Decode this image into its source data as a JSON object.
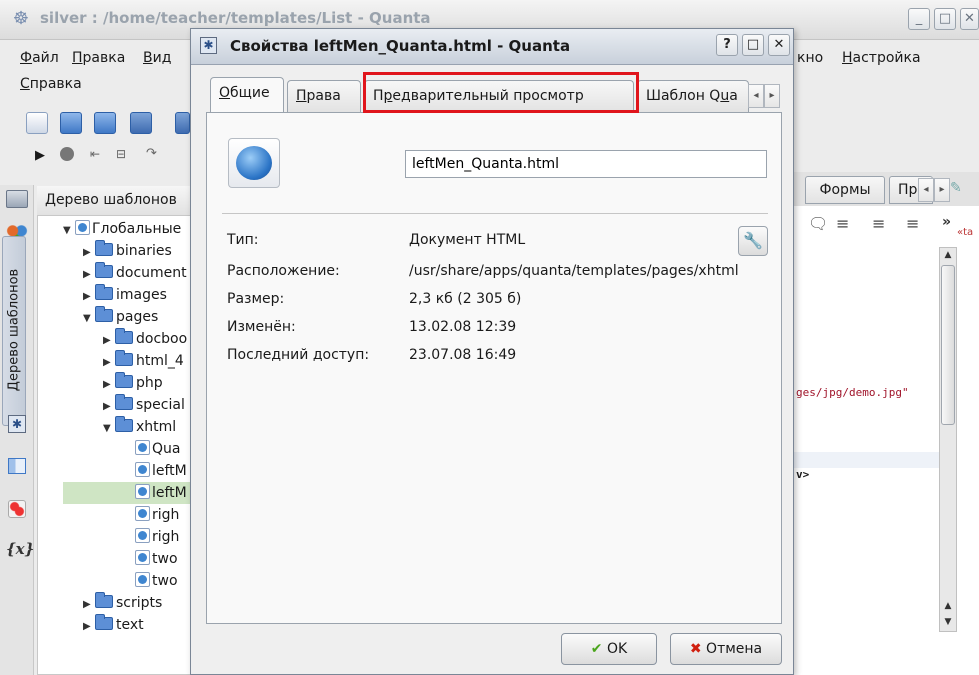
{
  "main_window": {
    "title": "silver : /home/teacher/templates/List - Quanta",
    "menu": [
      {
        "label": "Файл",
        "underline": "Ф",
        "rest": "айл"
      },
      {
        "label": "Правка",
        "underline": "П",
        "rest": "равка"
      },
      {
        "label": "Вид",
        "underline": "В",
        "rest": "ид"
      }
    ],
    "menu_right": [
      {
        "label": "кно"
      },
      {
        "label": "Настройка",
        "underline": "Н",
        "rest": "астройка"
      }
    ],
    "menu_row2": {
      "label": "Справка",
      "underline": "С",
      "rest": "правка"
    },
    "side_tab_label": "Дерево шаблонов",
    "tree_header": "Дерево шаблонов",
    "tree": [
      {
        "label": "Глобальные",
        "indent": 0,
        "expanded": true,
        "kind": "root"
      },
      {
        "label": "binaries",
        "indent": 1,
        "expanded": false,
        "kind": "folder"
      },
      {
        "label": "document",
        "indent": 1,
        "expanded": false,
        "kind": "folder"
      },
      {
        "label": "images",
        "indent": 1,
        "expanded": false,
        "kind": "folder"
      },
      {
        "label": "pages",
        "indent": 1,
        "expanded": true,
        "kind": "folder"
      },
      {
        "label": "docboo",
        "indent": 2,
        "expanded": false,
        "kind": "folder"
      },
      {
        "label": "html_4",
        "indent": 2,
        "expanded": false,
        "kind": "folder"
      },
      {
        "label": "php",
        "indent": 2,
        "expanded": false,
        "kind": "folder"
      },
      {
        "label": "special",
        "indent": 2,
        "expanded": false,
        "kind": "folder"
      },
      {
        "label": "xhtml",
        "indent": 2,
        "expanded": true,
        "kind": "folder"
      },
      {
        "label": "Qua",
        "indent": 3,
        "kind": "file"
      },
      {
        "label": "leftM",
        "indent": 3,
        "kind": "file"
      },
      {
        "label": "leftM",
        "indent": 3,
        "kind": "file",
        "selected": true
      },
      {
        "label": "righ",
        "indent": 3,
        "kind": "file"
      },
      {
        "label": "righ",
        "indent": 3,
        "kind": "file"
      },
      {
        "label": "two",
        "indent": 3,
        "kind": "file"
      },
      {
        "label": "two",
        "indent": 3,
        "kind": "file"
      },
      {
        "label": "scripts",
        "indent": 1,
        "expanded": false,
        "kind": "folder"
      },
      {
        "label": "text",
        "indent": 1,
        "expanded": false,
        "kind": "folder"
      }
    ],
    "editor_tabs": [
      "Формы",
      "Пр"
    ],
    "editor_snippet_1": "ges/jpg/demo.jpg\"",
    "editor_snippet_2": "v>",
    "editor_misc": "«ta"
  },
  "dialog": {
    "title": "Свойства leftMen_Quanta.html - Quanta",
    "tabs": [
      {
        "label": "Общие",
        "underline": "О",
        "rest": "бщие",
        "active": true
      },
      {
        "label": "Права",
        "underline": "П",
        "rest": "рава"
      },
      {
        "label": "Предварительный просмотр",
        "underline": "р",
        "pre": "П",
        "rest": "едварительный просмотр"
      },
      {
        "label": "Шаблон Quanta",
        "pre": "Шаблон Q",
        "underline": "u",
        "rest": "a"
      }
    ],
    "filename": "leftMen_Quanta.html",
    "properties": [
      {
        "label": "Тип:",
        "value": "Документ HTML"
      },
      {
        "label": "Расположение:",
        "value": "/usr/share/apps/quanta/templates/pages/xhtml"
      },
      {
        "label": "Размер:",
        "value": "2,3 кб (2 305 б)"
      },
      {
        "label": "Изменён:",
        "value": "13.02.08 12:39"
      },
      {
        "label": "Последний доступ:",
        "value": "23.07.08 16:49"
      }
    ],
    "ok_label": "OK",
    "cancel_label": "Отмена",
    "help_symbol": "?",
    "colors": {
      "highlight": "#e0151c",
      "ok_icon": "#4aa51c",
      "cancel_icon": "#d02010"
    }
  }
}
